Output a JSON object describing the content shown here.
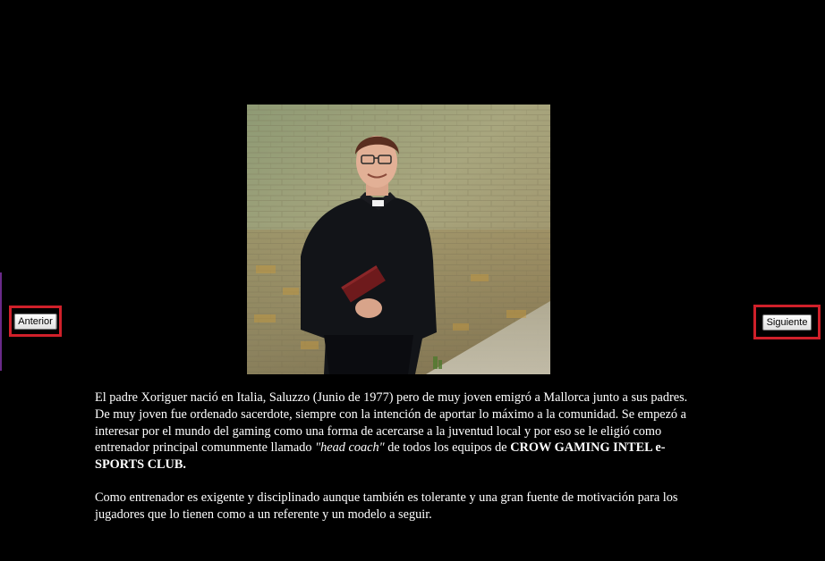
{
  "nav": {
    "previous_label": "Anterior",
    "next_label": "Siguiente"
  },
  "photo": {
    "subject": "priest-portrait"
  },
  "bio": {
    "p1_part1": "El padre Xoriguer nació en Italia, Saluzzo (Junio de 1977) pero de muy joven emigró a Mallorca junto a sus padres. De muy joven fue ordenado sacerdote, siempre con la intención de aportar lo máximo a la comunidad. Se empezó a interesar por el mundo del gaming como una forma de acercarse a la juventud local y por eso se le eligió como entrenador principal comunmente llamado ",
    "p1_emphasis": "\"head coach\"",
    "p1_part2": " de todos los equipos de ",
    "p1_strong": "CROW GAMING INTEL e-SPORTS CLUB.",
    "p2": "Como entrenador es exigente y disciplinado aunque también es tolerante y una gran fuente de motivación para los jugadores que lo tienen como a un referente y un modelo a seguir."
  },
  "colors": {
    "background": "#000000",
    "highlight_frame": "#d0202a",
    "text": "#ffffff"
  }
}
